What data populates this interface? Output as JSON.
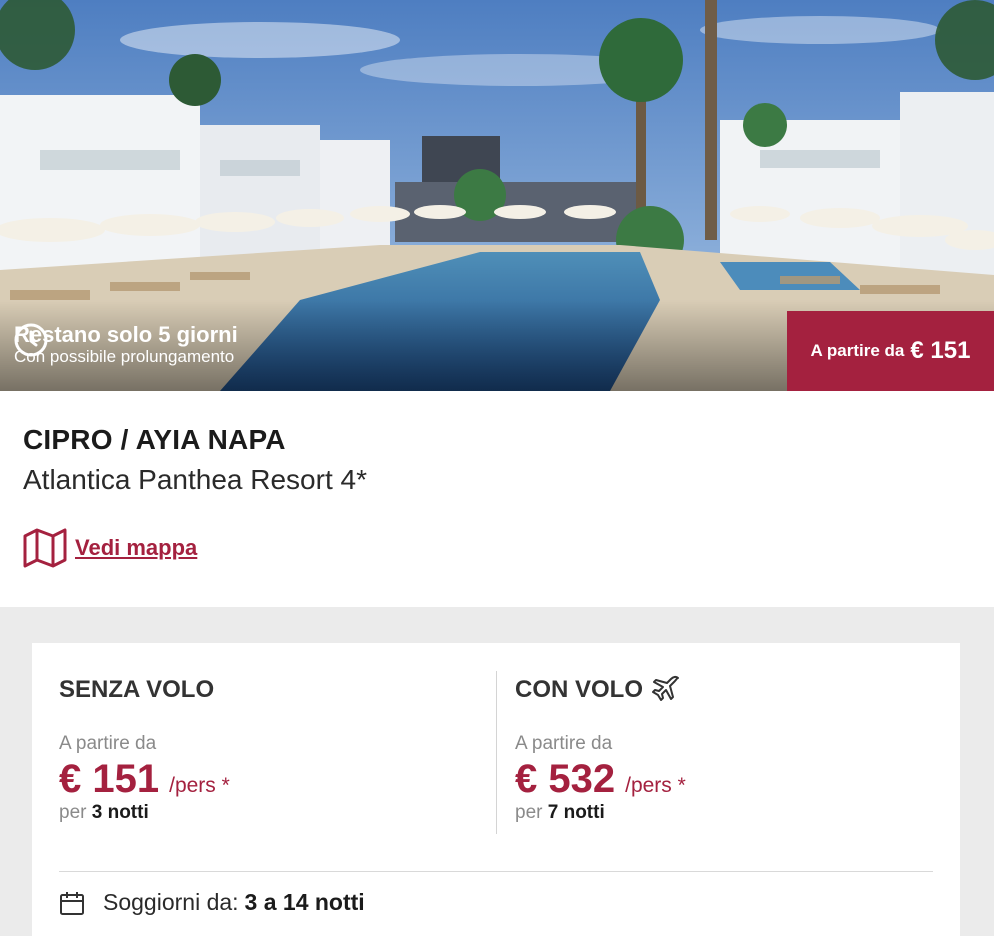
{
  "hero": {
    "countdown_title": "Restano solo 5 giorni",
    "countdown_subtitle": "Con possibile prolungamento",
    "price_label": "A partire da",
    "price_value": "€ 151",
    "accent_color": "#a4213f"
  },
  "header": {
    "destination": "CIPRO / AYIA NAPA",
    "hotel_name": "Atlantica Panthea Resort 4*",
    "map_link": "Vedi mappa"
  },
  "offers": [
    {
      "title": "SENZA VOLO",
      "from_label": "A partire da",
      "price": "€ 151",
      "per": "/pers *",
      "nights_prefix": "per",
      "nights": "3 notti"
    },
    {
      "title": "CON VOLO",
      "icon": "plane-icon",
      "from_label": "A partire da",
      "price": "€ 532",
      "per": "/pers *",
      "nights_prefix": "per",
      "nights": "7 notti"
    }
  ],
  "stays": {
    "label": "Soggiorni da:",
    "value": "3 a 14 notti"
  }
}
